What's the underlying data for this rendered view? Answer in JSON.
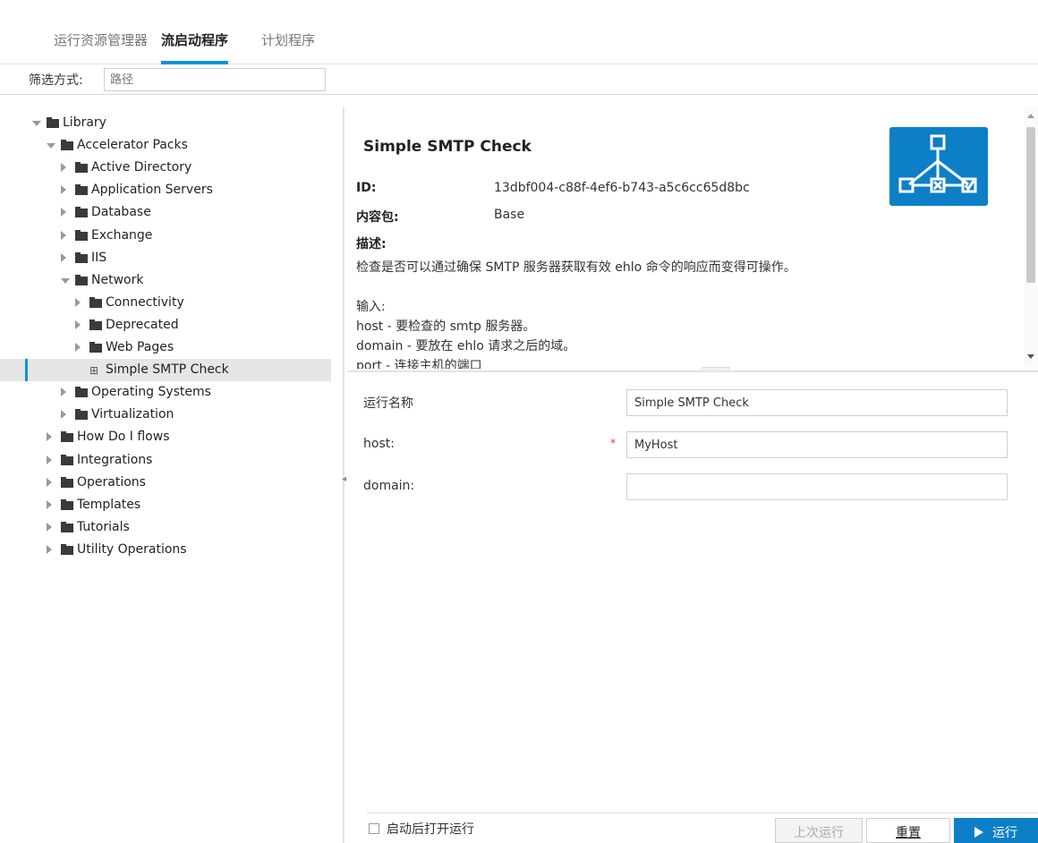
{
  "tabs": [
    {
      "label": "运行资源管理器",
      "active": false
    },
    {
      "label": "流启动程序",
      "active": true
    },
    {
      "label": "计划程序",
      "active": false
    }
  ],
  "filter": {
    "label": "筛选方式:",
    "placeholder": "路径"
  },
  "tree": [
    {
      "label": "Library",
      "depth": 0,
      "state": "open",
      "type": "folder"
    },
    {
      "label": "Accelerator Packs",
      "depth": 1,
      "state": "open",
      "type": "folder"
    },
    {
      "label": "Active Directory",
      "depth": 2,
      "state": "closed",
      "type": "folder"
    },
    {
      "label": "Application Servers",
      "depth": 2,
      "state": "closed",
      "type": "folder"
    },
    {
      "label": "Database",
      "depth": 2,
      "state": "closed",
      "type": "folder"
    },
    {
      "label": "Exchange",
      "depth": 2,
      "state": "closed",
      "type": "folder"
    },
    {
      "label": "IIS",
      "depth": 2,
      "state": "closed",
      "type": "folder"
    },
    {
      "label": "Network",
      "depth": 2,
      "state": "open",
      "type": "folder"
    },
    {
      "label": "Connectivity",
      "depth": 3,
      "state": "closed",
      "type": "folder"
    },
    {
      "label": "Deprecated",
      "depth": 3,
      "state": "closed",
      "type": "folder"
    },
    {
      "label": "Web Pages",
      "depth": 3,
      "state": "closed",
      "type": "folder"
    },
    {
      "label": "Simple SMTP Check",
      "depth": 3,
      "state": "none",
      "type": "flow",
      "selected": true
    },
    {
      "label": "Operating Systems",
      "depth": 2,
      "state": "closed",
      "type": "folder"
    },
    {
      "label": "Virtualization",
      "depth": 2,
      "state": "closed",
      "type": "folder"
    },
    {
      "label": "How Do I flows",
      "depth": 1,
      "state": "closed",
      "type": "folder"
    },
    {
      "label": "Integrations",
      "depth": 1,
      "state": "closed",
      "type": "folder"
    },
    {
      "label": "Operations",
      "depth": 1,
      "state": "closed",
      "type": "folder"
    },
    {
      "label": "Templates",
      "depth": 1,
      "state": "closed",
      "type": "folder"
    },
    {
      "label": "Tutorials",
      "depth": 1,
      "state": "closed",
      "type": "folder"
    },
    {
      "label": "Utility Operations",
      "depth": 1,
      "state": "closed",
      "type": "folder"
    }
  ],
  "details": {
    "title": "Simple SMTP Check",
    "id_label": "ID:",
    "id_value": "13dbf004-c88f-4ef6-b743-a5c6cc65d8bc",
    "pack_label": "内容包:",
    "pack_value": "Base",
    "desc_label": "描述:",
    "desc_lines": [
      "检查是否可以通过确保 SMTP 服务器获取有效 ehlo 命令的响应而变得可操作。",
      "",
      "输入:",
      "host - 要检查的 smtp 服务器。",
      "domain - 要放在 ehlo 请求之后的域。",
      "port - 连接主机的端口"
    ]
  },
  "form": {
    "run_name_label": "运行名称",
    "run_name_value": "Simple SMTP Check",
    "host_label": "host:",
    "host_value": "MyHost",
    "required_mark": "*",
    "domain_label": "domain:",
    "domain_value": ""
  },
  "footer": {
    "open_after_launch_label": "启动后打开运行",
    "last_run_label": "上次运行",
    "reset_label": "重置",
    "run_label": "运行"
  },
  "colors": {
    "accent": "#0096d6",
    "run_button": "#0d7fc7",
    "required": "#d9363e"
  }
}
